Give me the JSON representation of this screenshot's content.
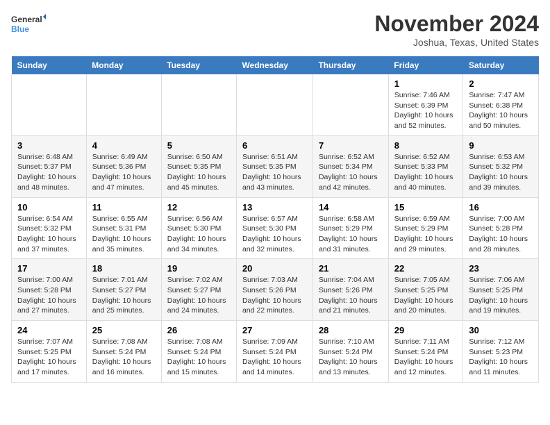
{
  "logo": {
    "line1": "General",
    "line2": "Blue"
  },
  "title": "November 2024",
  "location": "Joshua, Texas, United States",
  "days_of_week": [
    "Sunday",
    "Monday",
    "Tuesday",
    "Wednesday",
    "Thursday",
    "Friday",
    "Saturday"
  ],
  "weeks": [
    [
      {
        "day": "",
        "detail": ""
      },
      {
        "day": "",
        "detail": ""
      },
      {
        "day": "",
        "detail": ""
      },
      {
        "day": "",
        "detail": ""
      },
      {
        "day": "",
        "detail": ""
      },
      {
        "day": "1",
        "detail": "Sunrise: 7:46 AM\nSunset: 6:39 PM\nDaylight: 10 hours and 52 minutes."
      },
      {
        "day": "2",
        "detail": "Sunrise: 7:47 AM\nSunset: 6:38 PM\nDaylight: 10 hours and 50 minutes."
      }
    ],
    [
      {
        "day": "3",
        "detail": "Sunrise: 6:48 AM\nSunset: 5:37 PM\nDaylight: 10 hours and 48 minutes."
      },
      {
        "day": "4",
        "detail": "Sunrise: 6:49 AM\nSunset: 5:36 PM\nDaylight: 10 hours and 47 minutes."
      },
      {
        "day": "5",
        "detail": "Sunrise: 6:50 AM\nSunset: 5:35 PM\nDaylight: 10 hours and 45 minutes."
      },
      {
        "day": "6",
        "detail": "Sunrise: 6:51 AM\nSunset: 5:35 PM\nDaylight: 10 hours and 43 minutes."
      },
      {
        "day": "7",
        "detail": "Sunrise: 6:52 AM\nSunset: 5:34 PM\nDaylight: 10 hours and 42 minutes."
      },
      {
        "day": "8",
        "detail": "Sunrise: 6:52 AM\nSunset: 5:33 PM\nDaylight: 10 hours and 40 minutes."
      },
      {
        "day": "9",
        "detail": "Sunrise: 6:53 AM\nSunset: 5:32 PM\nDaylight: 10 hours and 39 minutes."
      }
    ],
    [
      {
        "day": "10",
        "detail": "Sunrise: 6:54 AM\nSunset: 5:32 PM\nDaylight: 10 hours and 37 minutes."
      },
      {
        "day": "11",
        "detail": "Sunrise: 6:55 AM\nSunset: 5:31 PM\nDaylight: 10 hours and 35 minutes."
      },
      {
        "day": "12",
        "detail": "Sunrise: 6:56 AM\nSunset: 5:30 PM\nDaylight: 10 hours and 34 minutes."
      },
      {
        "day": "13",
        "detail": "Sunrise: 6:57 AM\nSunset: 5:30 PM\nDaylight: 10 hours and 32 minutes."
      },
      {
        "day": "14",
        "detail": "Sunrise: 6:58 AM\nSunset: 5:29 PM\nDaylight: 10 hours and 31 minutes."
      },
      {
        "day": "15",
        "detail": "Sunrise: 6:59 AM\nSunset: 5:29 PM\nDaylight: 10 hours and 29 minutes."
      },
      {
        "day": "16",
        "detail": "Sunrise: 7:00 AM\nSunset: 5:28 PM\nDaylight: 10 hours and 28 minutes."
      }
    ],
    [
      {
        "day": "17",
        "detail": "Sunrise: 7:00 AM\nSunset: 5:28 PM\nDaylight: 10 hours and 27 minutes."
      },
      {
        "day": "18",
        "detail": "Sunrise: 7:01 AM\nSunset: 5:27 PM\nDaylight: 10 hours and 25 minutes."
      },
      {
        "day": "19",
        "detail": "Sunrise: 7:02 AM\nSunset: 5:27 PM\nDaylight: 10 hours and 24 minutes."
      },
      {
        "day": "20",
        "detail": "Sunrise: 7:03 AM\nSunset: 5:26 PM\nDaylight: 10 hours and 22 minutes."
      },
      {
        "day": "21",
        "detail": "Sunrise: 7:04 AM\nSunset: 5:26 PM\nDaylight: 10 hours and 21 minutes."
      },
      {
        "day": "22",
        "detail": "Sunrise: 7:05 AM\nSunset: 5:25 PM\nDaylight: 10 hours and 20 minutes."
      },
      {
        "day": "23",
        "detail": "Sunrise: 7:06 AM\nSunset: 5:25 PM\nDaylight: 10 hours and 19 minutes."
      }
    ],
    [
      {
        "day": "24",
        "detail": "Sunrise: 7:07 AM\nSunset: 5:25 PM\nDaylight: 10 hours and 17 minutes."
      },
      {
        "day": "25",
        "detail": "Sunrise: 7:08 AM\nSunset: 5:24 PM\nDaylight: 10 hours and 16 minutes."
      },
      {
        "day": "26",
        "detail": "Sunrise: 7:08 AM\nSunset: 5:24 PM\nDaylight: 10 hours and 15 minutes."
      },
      {
        "day": "27",
        "detail": "Sunrise: 7:09 AM\nSunset: 5:24 PM\nDaylight: 10 hours and 14 minutes."
      },
      {
        "day": "28",
        "detail": "Sunrise: 7:10 AM\nSunset: 5:24 PM\nDaylight: 10 hours and 13 minutes."
      },
      {
        "day": "29",
        "detail": "Sunrise: 7:11 AM\nSunset: 5:24 PM\nDaylight: 10 hours and 12 minutes."
      },
      {
        "day": "30",
        "detail": "Sunrise: 7:12 AM\nSunset: 5:23 PM\nDaylight: 10 hours and 11 minutes."
      }
    ]
  ]
}
